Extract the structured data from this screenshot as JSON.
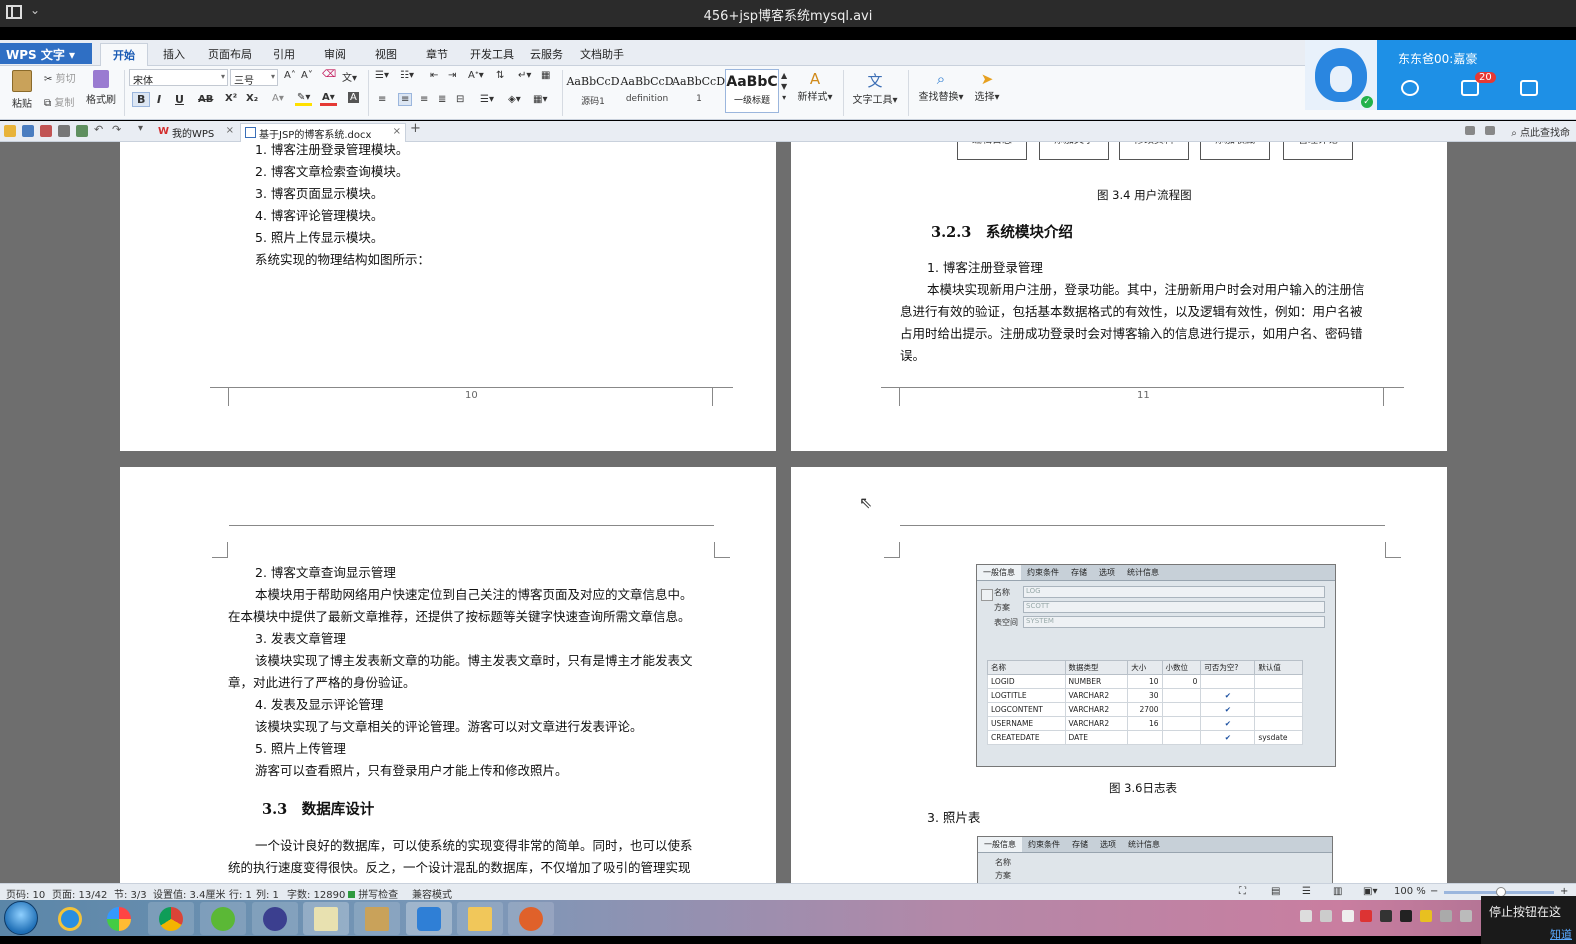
{
  "window": {
    "title": "456+jsp博客系统mysql.avi"
  },
  "wps": {
    "app_button": "WPS 文字",
    "ribbon_tabs": [
      "开始",
      "插入",
      "页面布局",
      "引用",
      "审阅",
      "视图",
      "章节",
      "开发工具",
      "云服务",
      "文档助手"
    ],
    "active_tab": "开始",
    "clipboard": {
      "paste": "粘贴",
      "cut": "剪切",
      "copy": "复制",
      "format_painter": "格式刷"
    },
    "font_name": "宋体",
    "font_size": "三号",
    "format_buttons": {
      "bold": "B",
      "italic": "I",
      "underline": "U",
      "strike": "AB",
      "superscript": "X²",
      "subscript": "X₂"
    },
    "styles": [
      {
        "preview": "AaBbCcD",
        "name": "源码1"
      },
      {
        "preview": "AaBbCcD",
        "name": "definition"
      },
      {
        "preview": "AaBbCcDd",
        "name": "1"
      },
      {
        "preview": "AaBbC",
        "name": "一级标题"
      }
    ],
    "tools": {
      "new_style": "新样式",
      "text_tools": "文字工具",
      "find_replace": "查找替换",
      "select": "选择"
    }
  },
  "notification": {
    "name": "东东爸00:嘉豪",
    "badge": "20"
  },
  "doc_tabs": [
    {
      "label": "我的WPS",
      "active": false
    },
    {
      "label": "基于JSP的博客系统.docx",
      "active": true
    }
  ],
  "find_hint": "点此查找命",
  "pages": {
    "p10": {
      "lines": [
        "1. 博客注册登录管理模块。",
        "2. 博客文章检索查询模块。",
        "3. 博客页面显示模块。",
        "4. 博客评论管理模块。",
        "5. 照片上传显示模块。",
        "系统实现的物理结构如图所示："
      ],
      "page_number": "10"
    },
    "p11": {
      "flow_boxes": [
        "编辑日志",
        "添加文字",
        "修改资料",
        "添加收藏",
        "管理评论"
      ],
      "caption": "图 3.4 用户流程图",
      "heading": "3.2.3　系统模块介绍",
      "item": "1. 博客注册登录管理",
      "body": [
        "本模块实现新用户注册，登录功能。其中，注册新用户时会对用户输入的注册信",
        "息进行有效的验证，包括基本数据格式的有效性，以及逻辑有效性，例如：用户名被",
        "占用时给出提示。注册成功登录时会对博客输入的信息进行提示，如用户名、密码错",
        "误。"
      ],
      "page_number": "11"
    },
    "p12": {
      "lines": [
        "2. 博客文章查询显示管理",
        "本模块用于帮助网络用户快速定位到自己关注的博客页面及对应的文章信息中。",
        "在本模块中提供了最新文章推荐，还提供了按标题等关键字快速查询所需文章信息。",
        "3. 发表文章管理",
        "该模块实现了博主发表新文章的功能。博主发表文章时，只有是博主才能发表文",
        "章，对此进行了严格的身份验证。",
        "4. 发表及显示评论管理",
        "该模块实现了与文章相关的评论管理。游客可以对文章进行发表评论。",
        "5. 照片上传管理",
        "游客可以查看照片，只有登录用户才能上传和修改照片。"
      ],
      "heading": "3.3　数据库设计",
      "tail": [
        "一个设计良好的数据库，可以使系统的实现变得非常的简单。同时，也可以使系",
        "统的执行速度变得很快。反之，一个设计混乱的数据库，不仅增加了吸引的管理实现"
      ]
    },
    "p13": {
      "db_tabs": [
        "一般信息",
        "约束条件",
        "存储",
        "选项",
        "统计信息"
      ],
      "db_fields": [
        {
          "label": "名称",
          "value": "LOG"
        },
        {
          "label": "方案",
          "value": "SCOTT"
        },
        {
          "label": "表空间",
          "value": "SYSTEM"
        }
      ],
      "db_headers": [
        "名称",
        "数据类型",
        "大小",
        "小数位",
        "可否为空?",
        "默认值"
      ],
      "db_rows": [
        [
          "LOGID",
          "NUMBER",
          "10",
          "0",
          "",
          ""
        ],
        [
          "LOGTITLE",
          "VARCHAR2",
          "30",
          "",
          "✔",
          ""
        ],
        [
          "LOGCONTENT",
          "VARCHAR2",
          "2700",
          "",
          "✔",
          ""
        ],
        [
          "USERNAME",
          "VARCHAR2",
          "16",
          "",
          "✔",
          ""
        ],
        [
          "CREATEDATE",
          "DATE",
          "",
          "",
          "✔",
          "sysdate"
        ]
      ],
      "caption": "图 3.6日志表",
      "item": "3. 照片表"
    }
  },
  "status": {
    "page": "页码: 10",
    "pages": "页面: 13/42",
    "section": "节: 3/3",
    "setting": "设置值: 3.4厘米",
    "row": "行: 1",
    "col": "列: 1",
    "words": "字数: 12890",
    "spell": "拼写检查",
    "compat": "兼容模式",
    "zoom": "100 %"
  },
  "stop_tip": {
    "text": "停止按钮在这",
    "link": "知道"
  }
}
